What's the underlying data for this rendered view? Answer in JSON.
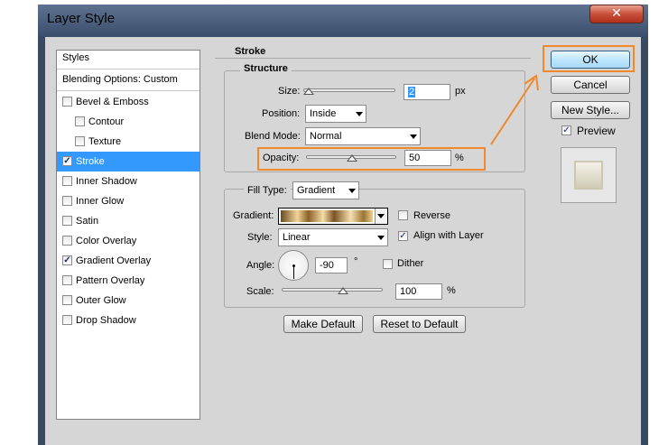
{
  "window": {
    "title": "Layer Style",
    "close_symbol": "✕"
  },
  "styles_panel": {
    "header": "Styles",
    "blending_options": "Blending Options: Custom",
    "items": [
      {
        "label": "Bevel & Emboss",
        "checked": false
      },
      {
        "label": "Contour",
        "checked": false
      },
      {
        "label": "Texture",
        "checked": false
      },
      {
        "label": "Stroke",
        "checked": true
      },
      {
        "label": "Inner Shadow",
        "checked": false
      },
      {
        "label": "Inner Glow",
        "checked": false
      },
      {
        "label": "Satin",
        "checked": false
      },
      {
        "label": "Color Overlay",
        "checked": false
      },
      {
        "label": "Gradient Overlay",
        "checked": true
      },
      {
        "label": "Pattern Overlay",
        "checked": false
      },
      {
        "label": "Outer Glow",
        "checked": false
      },
      {
        "label": "Drop Shadow",
        "checked": false
      }
    ]
  },
  "stroke": {
    "section_title": "Stroke",
    "structure_title": "Structure",
    "size_label": "Size:",
    "size_value": "2",
    "size_unit": "px",
    "size_slider_fraction": 0.02,
    "position_label": "Position:",
    "position_value": "Inside",
    "blend_mode_label": "Blend Mode:",
    "blend_mode_value": "Normal",
    "opacity_label": "Opacity:",
    "opacity_value": "50",
    "opacity_unit": "%",
    "opacity_fraction": 0.5
  },
  "fill": {
    "fill_type_label": "Fill Type:",
    "fill_type_value": "Gradient",
    "gradient_label": "Gradient:",
    "reverse_label": "Reverse",
    "reverse_checked": false,
    "style_label": "Style:",
    "style_value": "Linear",
    "align_label": "Align with Layer",
    "align_checked": true,
    "angle_label": "Angle:",
    "angle_value": "-90",
    "angle_unit": "°",
    "dither_label": "Dither",
    "dither_checked": false,
    "scale_label": "Scale:",
    "scale_value": "100",
    "scale_unit": "%",
    "scale_slider_fraction": 0.5
  },
  "buttons": {
    "make_default": "Make Default",
    "reset_to_default": "Reset to Default",
    "ok": "OK",
    "cancel": "Cancel",
    "new_style": "New Style...",
    "preview_label": "Preview",
    "preview_checked": true
  },
  "colors": {
    "annotation": "#f0882c",
    "selection": "#3399ff",
    "dialog_bg": "#d6d6d6"
  }
}
